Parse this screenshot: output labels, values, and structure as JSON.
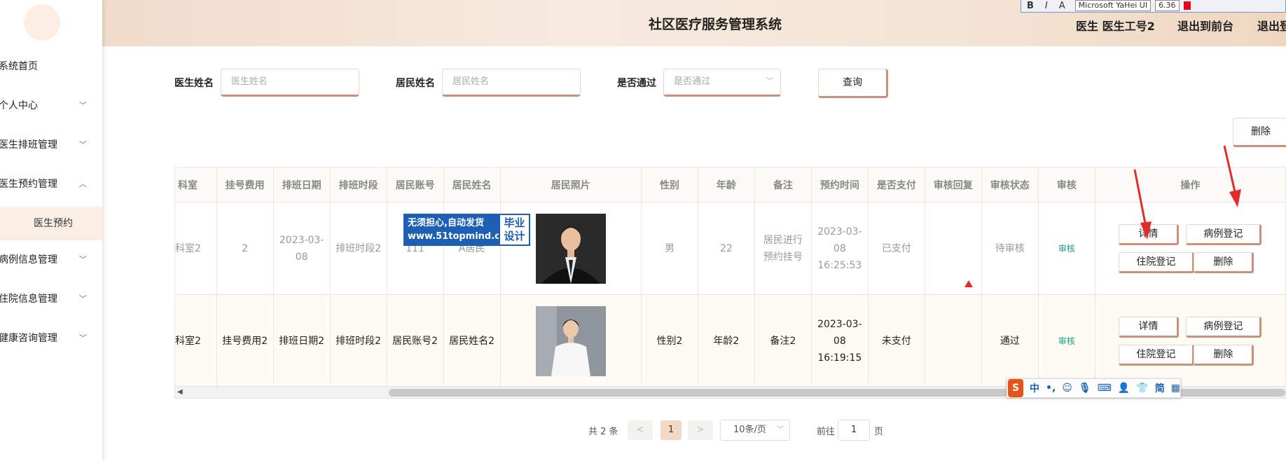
{
  "app": {
    "title": "社区医疗服务管理系统"
  },
  "header": {
    "user": "医生 医生工号2",
    "back_link": "退出到前台",
    "logout_link": "退出登"
  },
  "toolbar_float": {
    "bold": "B",
    "italic": "I",
    "font": "Microsoft YaHei UI",
    "size": "6.36"
  },
  "sidebar": {
    "items": [
      {
        "label": "系统首页",
        "has_children": false
      },
      {
        "label": "个人中心",
        "has_children": true,
        "expanded": false
      },
      {
        "label": "医生排班管理",
        "has_children": true,
        "expanded": false
      },
      {
        "label": "医生预约管理",
        "has_children": true,
        "expanded": true
      },
      {
        "label": "病例信息管理",
        "has_children": true,
        "expanded": false
      },
      {
        "label": "住院信息管理",
        "has_children": true,
        "expanded": false
      },
      {
        "label": "健康咨询管理",
        "has_children": true,
        "expanded": false
      }
    ],
    "active_sub": "医生预约"
  },
  "search": {
    "doctor_label": "医生姓名",
    "doctor_placeholder": "医生姓名",
    "resident_label": "居民姓名",
    "resident_placeholder": "居民姓名",
    "passed_label": "是否通过",
    "passed_placeholder": "是否通过",
    "query_button": "查询"
  },
  "toolbar": {
    "delete_button": "删除"
  },
  "table": {
    "columns": [
      "科室",
      "挂号费用",
      "排班日期",
      "排班时段",
      "居民账号",
      "居民姓名",
      "居民照片",
      "性别",
      "年龄",
      "备注",
      "预约时间",
      "是否支付",
      "审核回复",
      "审核状态",
      "审核",
      "操作"
    ],
    "rows": [
      {
        "dept": "科室2",
        "fee": "2",
        "date": "2023-03-08",
        "slot": "排班时段2",
        "account": "111",
        "name": "A居民",
        "gender": "男",
        "age": "22",
        "note": "居民进行预约挂号",
        "time": "2023-03-08 16:25:53",
        "paid": "已支付",
        "reply": "",
        "status": "待审核",
        "review": "审核"
      },
      {
        "dept": "科室2",
        "fee": "挂号费用2",
        "date": "排班日期2",
        "slot": "排班时段2",
        "account": "居民账号2",
        "name": "居民姓名2",
        "gender": "性别2",
        "age": "年龄2",
        "note": "备注2",
        "time": "2023-03-08 16:19:15",
        "paid": "未支付",
        "reply": "",
        "status": "通过",
        "review": "审核"
      }
    ],
    "row_actions": {
      "detail": "详情",
      "case": "病例登记",
      "hospital": "住院登记",
      "delete": "删除"
    }
  },
  "watermark": {
    "line1": "无须担心,自动发货",
    "line2": "www.51topmind.com",
    "right1": "毕业",
    "right2": "设计"
  },
  "ime": {
    "logo": "S",
    "mode": "中",
    "punct": "•,",
    "simplified": "简"
  },
  "pagination": {
    "total": "共 2 条",
    "prev": "<",
    "next": ">",
    "current": "1",
    "page_size": "10条/页",
    "goto_label": "前往",
    "goto_value": "1",
    "page_label": "页"
  },
  "colors": {
    "accent": "#c9917a",
    "active_bg": "#fbeee4",
    "review_link": "#1a9c8c",
    "annotation_arrow": "#e52b2b"
  }
}
